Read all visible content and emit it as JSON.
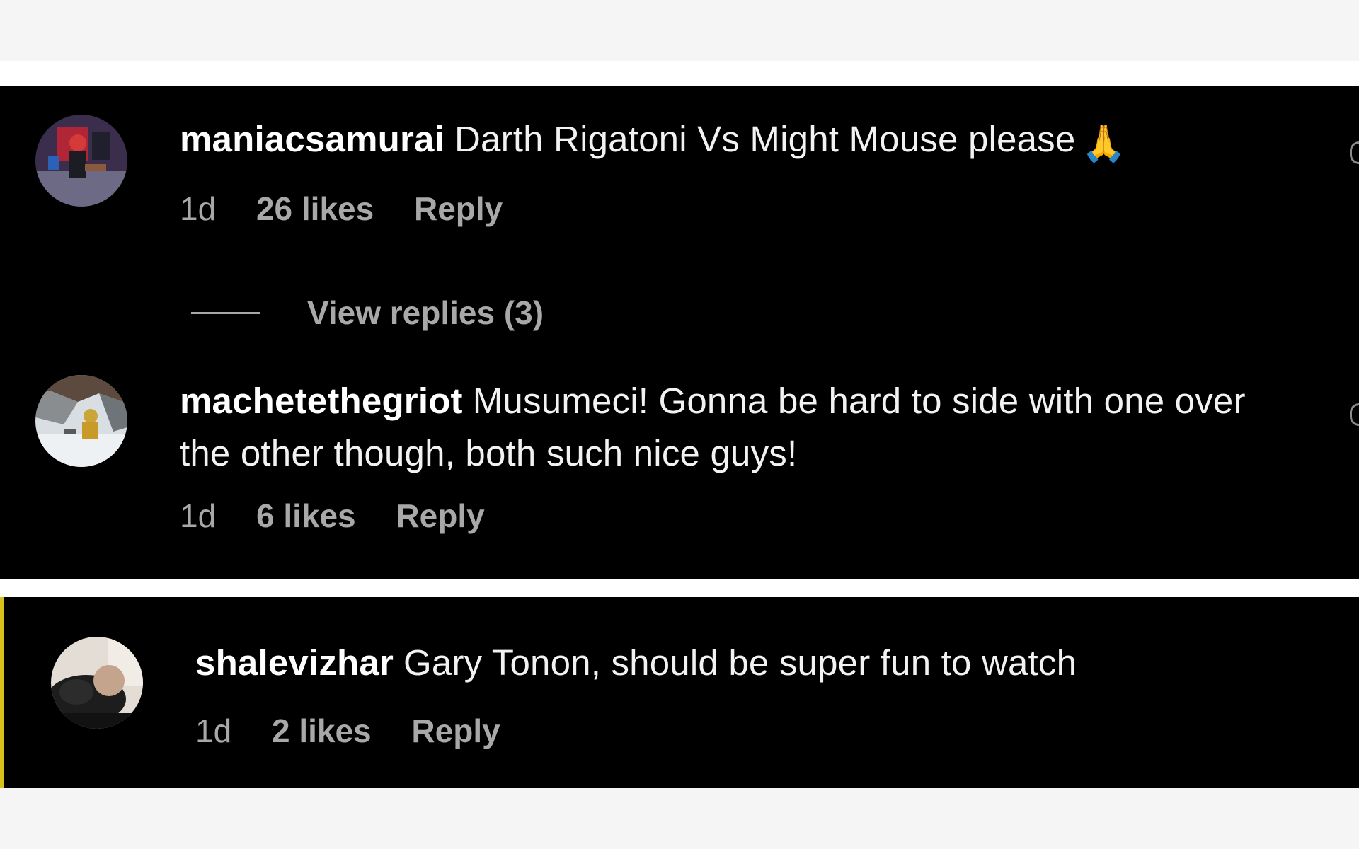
{
  "comments": [
    {
      "username": "maniacsamurai",
      "text": "Darth Rigatoni Vs Might Mouse please",
      "emoji": "🙏",
      "time": "1d",
      "likes": "26 likes",
      "reply": "Reply",
      "view_replies": "View replies (3)"
    },
    {
      "username": "machetethegriot",
      "text": "Musumeci! Gonna be hard to side with one over the other though, both such nice guys!",
      "time": "1d",
      "likes": "6 likes",
      "reply": "Reply"
    },
    {
      "username": "shalevizhar",
      "text": "Gary Tonon, should be super fun to watch",
      "time": "1d",
      "likes": "2 likes",
      "reply": "Reply"
    }
  ],
  "colors": {
    "panel_bg": "#000000",
    "meta_text": "#a8a8a8",
    "accent_bar": "#d8c21a"
  },
  "icons": [
    "avatar-image",
    "praying-hands-emoji",
    "heart-icon"
  ]
}
